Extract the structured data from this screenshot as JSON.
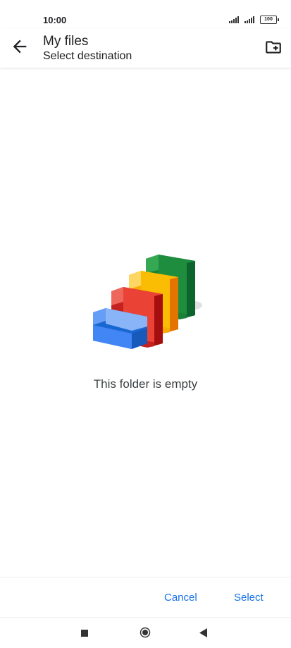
{
  "status_bar": {
    "time": "10:00",
    "battery": "100",
    "icons": [
      "signal-icon",
      "signal-icon",
      "battery-icon"
    ]
  },
  "app_bar": {
    "back_icon": "arrow-back-icon",
    "title": "My files",
    "subtitle": "Select destination",
    "new_folder_icon": "create-new-folder-icon"
  },
  "empty_state": {
    "illustration": "empty-folders-illustration",
    "message": "This folder is empty"
  },
  "actions": {
    "cancel_label": "Cancel",
    "select_label": "Select"
  },
  "nav_bar": {
    "icons": [
      "recents-icon",
      "home-icon",
      "back-icon"
    ]
  },
  "colors": {
    "accent": "#1a73e8",
    "folder_blue": "#4285f4",
    "folder_red": "#ea4335",
    "folder_yellow": "#fbbc04",
    "folder_green": "#34a853"
  }
}
